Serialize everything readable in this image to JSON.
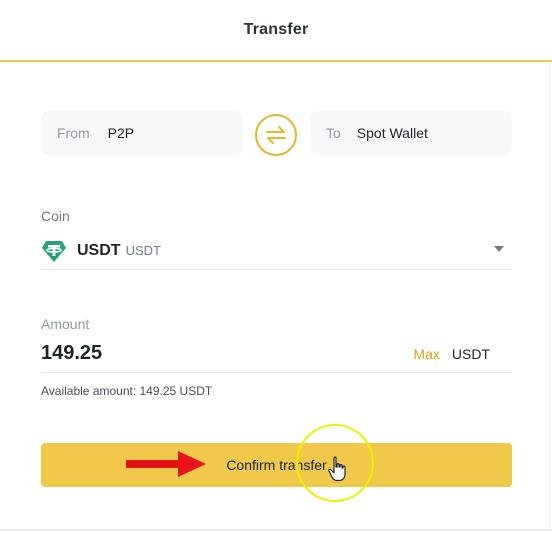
{
  "header": {
    "title": "Transfer"
  },
  "transfer": {
    "from_label": "From",
    "from_value": "P2P",
    "to_label": "To",
    "to_value": "Spot Wallet"
  },
  "coin": {
    "label": "Coin",
    "symbol": "USDT",
    "sub": "USDT",
    "icon": "tether-icon",
    "icon_color": "#26a17b"
  },
  "amount": {
    "label": "Amount",
    "value": "149.25",
    "max_label": "Max",
    "unit": "USDT"
  },
  "available_text": "Available amount: 149.25 USDT",
  "confirm_label": "Confirm transfer",
  "colors": {
    "accent": "#f0c94a",
    "max": "#d9a418",
    "arrow": "#e8141b",
    "highlight": "#eef000"
  }
}
